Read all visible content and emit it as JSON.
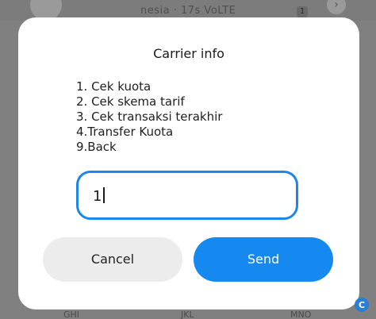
{
  "background": {
    "header_text": "      nesia · 17s VoLTE",
    "badge": "1",
    "keys": [
      "GHI",
      "JKL",
      "MNO"
    ]
  },
  "dialog": {
    "title": "Carrier info",
    "menu": [
      "1. Cek kuota",
      "2. Cek skema tarif",
      "3. Cek transaksi terakhir",
      "4.Transfer Kuota",
      "9.Back"
    ],
    "input_value": "1",
    "cancel_label": "Cancel",
    "send_label": "Send"
  },
  "colors": {
    "accent": "#1689f0",
    "input_border": "#1d86e8",
    "cancel_bg": "#ececec",
    "overlay": "#808080"
  },
  "icons": {
    "watermark": "watermark-logo-icon"
  }
}
